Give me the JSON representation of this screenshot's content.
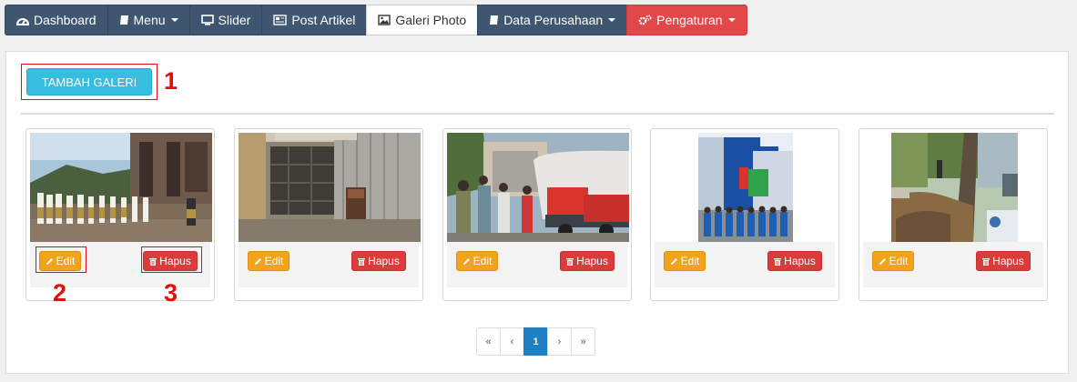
{
  "nav": {
    "items": [
      {
        "label": "Dashboard",
        "icon": "dashboard-icon"
      },
      {
        "label": "Menu",
        "icon": "book-icon",
        "dropdown": true
      },
      {
        "label": "Slider",
        "icon": "monitor-icon"
      },
      {
        "label": "Post Artikel",
        "icon": "newspaper-icon"
      },
      {
        "label": "Galeri Photo",
        "icon": "image-icon",
        "active": true
      },
      {
        "label": "Data Perusahaan",
        "icon": "book-icon",
        "dropdown": true
      },
      {
        "label": "Pengaturan",
        "icon": "gears-icon",
        "dropdown": true
      }
    ]
  },
  "toolbar": {
    "add_label": "TAMBAH GALERI"
  },
  "annotations": {
    "n1": "1",
    "n2": "2",
    "n3": "3"
  },
  "gallery": {
    "edit_label": "Edit",
    "delete_label": "Hapus",
    "photos": [
      {
        "subject": "ceremony-group-photo"
      },
      {
        "subject": "window-and-water-pipe-photo"
      },
      {
        "subject": "water-truck-crowd-photo"
      },
      {
        "subject": "pdam-office-building-photo"
      },
      {
        "subject": "tree-and-pipe-excavation-photo"
      }
    ]
  },
  "pagination": {
    "first": "«",
    "prev": "‹",
    "current": "1",
    "next": "›",
    "last": "»"
  },
  "colors": {
    "nav_bg": "#3f5670",
    "danger": "#e2474a",
    "info": "#37bde0",
    "warning": "#f1a31b",
    "primary": "#1f7fc3",
    "annotation": "#e01010"
  }
}
